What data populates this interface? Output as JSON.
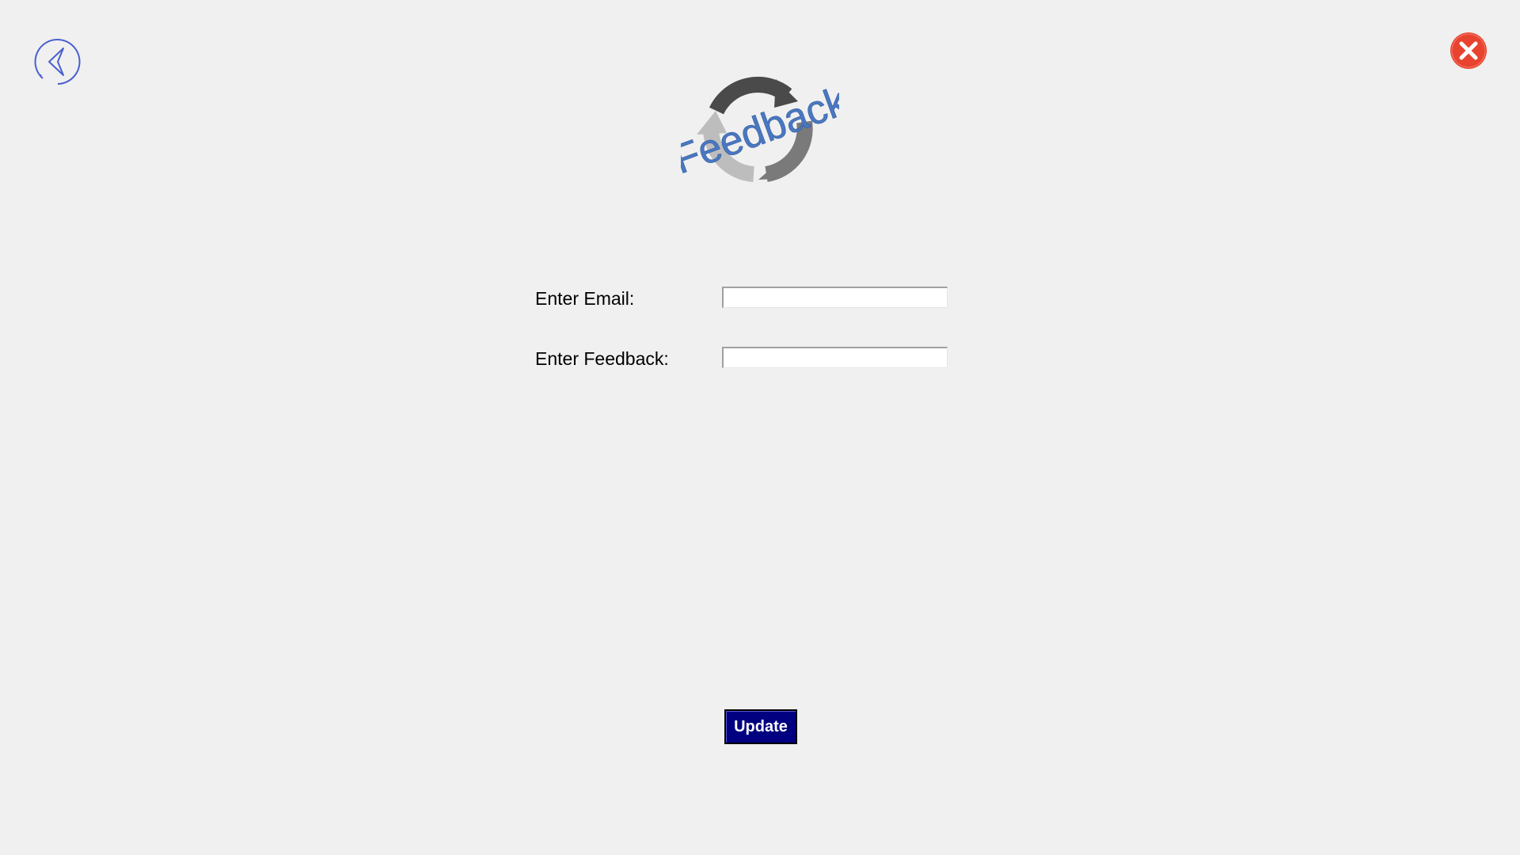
{
  "window": {
    "background": "#f0f0f0"
  },
  "header": {
    "back_icon": "back-arrow-circle-icon",
    "close_icon": "close-circle-icon",
    "close_color": "#e8432f",
    "back_color": "#4a5fd0"
  },
  "logo": {
    "text": "Feedback",
    "icon": "refresh-cycle-arrows-icon",
    "text_color": "#4a78c0"
  },
  "form": {
    "email_label": "Enter Email:",
    "email_value": "",
    "feedback_label": "Enter Feedback:",
    "feedback_value": ""
  },
  "actions": {
    "update_label": "Update",
    "update_color": "#000080"
  }
}
